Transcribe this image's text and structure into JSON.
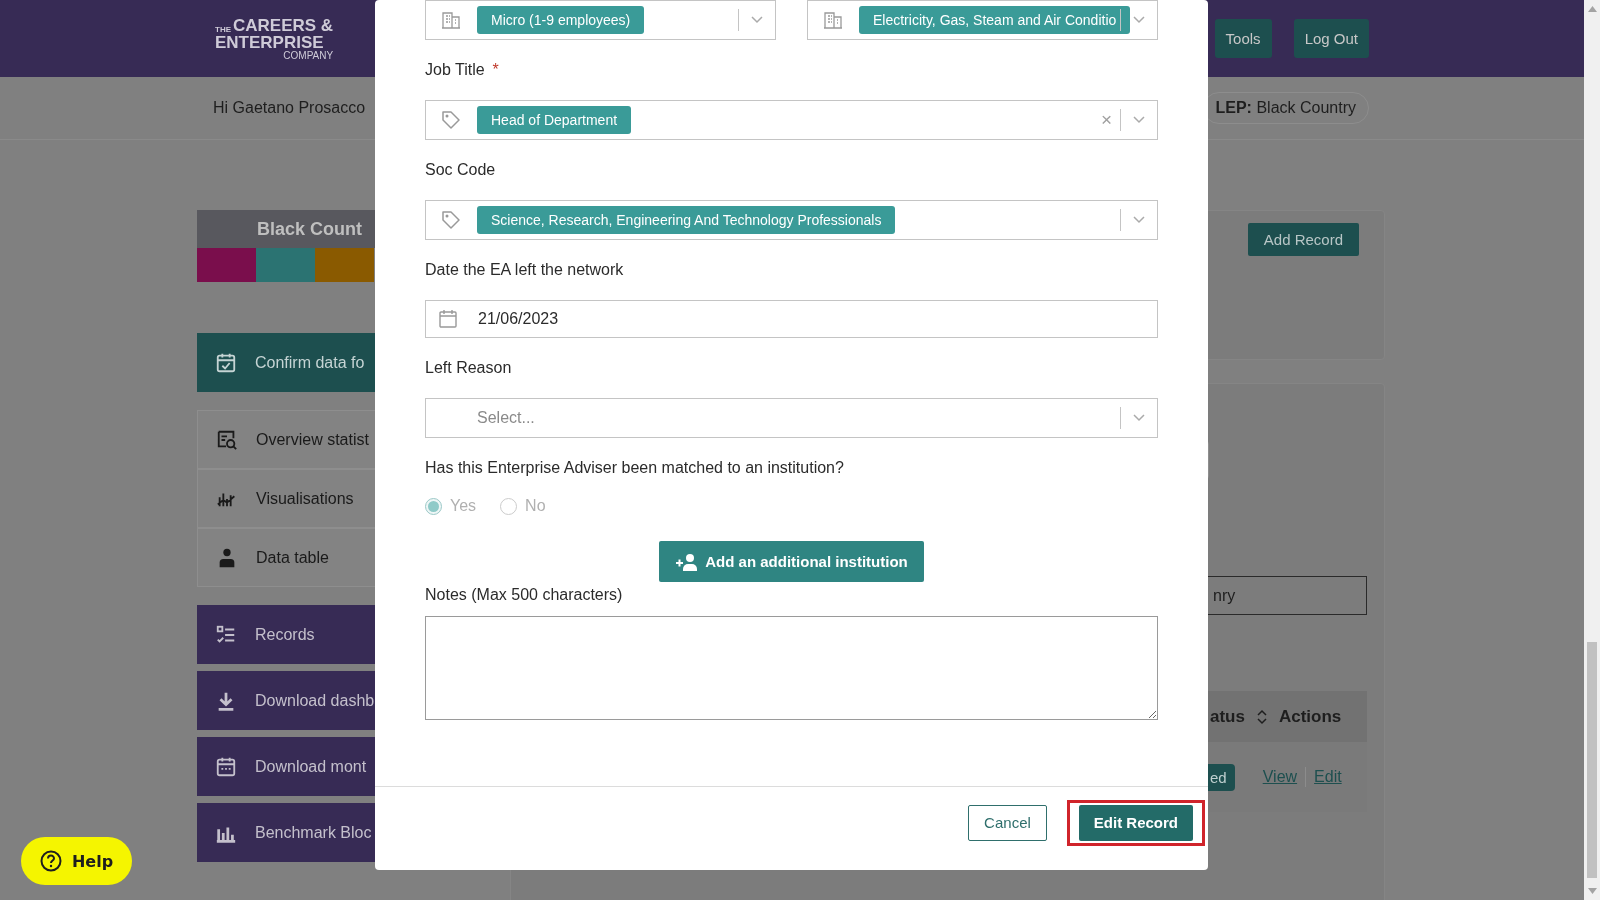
{
  "header": {
    "logo": {
      "small": "THE",
      "line1": "CAREERS &",
      "line2": "ENTERPRISE",
      "line3": "COMPANY"
    },
    "nav_buttons": [
      "Tools",
      "Log Out"
    ]
  },
  "subheader": {
    "greeting": "Hi Gaetano Prosacco",
    "lep_label": "LEP:",
    "lep_value": "Black Country"
  },
  "sidebar": {
    "banner": {
      "title": "Black Count",
      "stripes": [
        {
          "color": "#7a0e4c"
        },
        {
          "color": "#2b7372"
        },
        {
          "color": "#8a5a00"
        }
      ]
    },
    "items": [
      {
        "kind": "primary",
        "label": "Confirm data fo"
      },
      {
        "kind": "tab",
        "label": "Overview statist"
      },
      {
        "kind": "tab",
        "label": "Visualisations"
      },
      {
        "kind": "tab",
        "label": "Data table"
      },
      {
        "kind": "link",
        "label": "Records"
      },
      {
        "kind": "link",
        "label": "Download dashb"
      },
      {
        "kind": "link",
        "label": "Download mont"
      },
      {
        "kind": "link",
        "label": "Benchmark Bloc"
      }
    ]
  },
  "main": {
    "add_button": "Add Record",
    "search_value": "nry",
    "table": {
      "columns": [
        "atus",
        "Actions"
      ],
      "row": {
        "status": "ed",
        "actions": [
          "View",
          "Edit"
        ]
      }
    }
  },
  "modal": {
    "fields": [
      {
        "kind": "select-pair",
        "items": [
          {
            "value": "Micro (1-9 employees)"
          },
          {
            "value": "Electricity, Gas, Steam and Air Conditio"
          }
        ]
      },
      {
        "kind": "select",
        "label": "Job Title",
        "required_mark": "*",
        "value": "Head of Department",
        "clear_mark": "×"
      },
      {
        "kind": "select",
        "label": "Soc Code",
        "value": "Science, Research, Engineering And Technology Professionals"
      },
      {
        "kind": "date",
        "label": "Date the EA left the network",
        "value": "21/06/2023"
      },
      {
        "kind": "select",
        "label": "Left Reason",
        "placeholder": "Select..."
      },
      {
        "kind": "radio",
        "label": "Has this Enterprise Adviser been matched to an institution?",
        "disabled": true,
        "options": [
          {
            "label": "Yes",
            "selected": true
          },
          {
            "label": "No",
            "selected": false
          }
        ]
      },
      {
        "kind": "button",
        "label": "Add an additional institution"
      },
      {
        "kind": "textarea",
        "label": "Notes (Max 500 characters)"
      }
    ],
    "footer": [
      {
        "kind": "secondary",
        "label": "Cancel",
        "highlighted": false
      },
      {
        "kind": "primary",
        "label": "Edit Record",
        "highlighted": true
      }
    ]
  },
  "help": {
    "label": "Help"
  }
}
